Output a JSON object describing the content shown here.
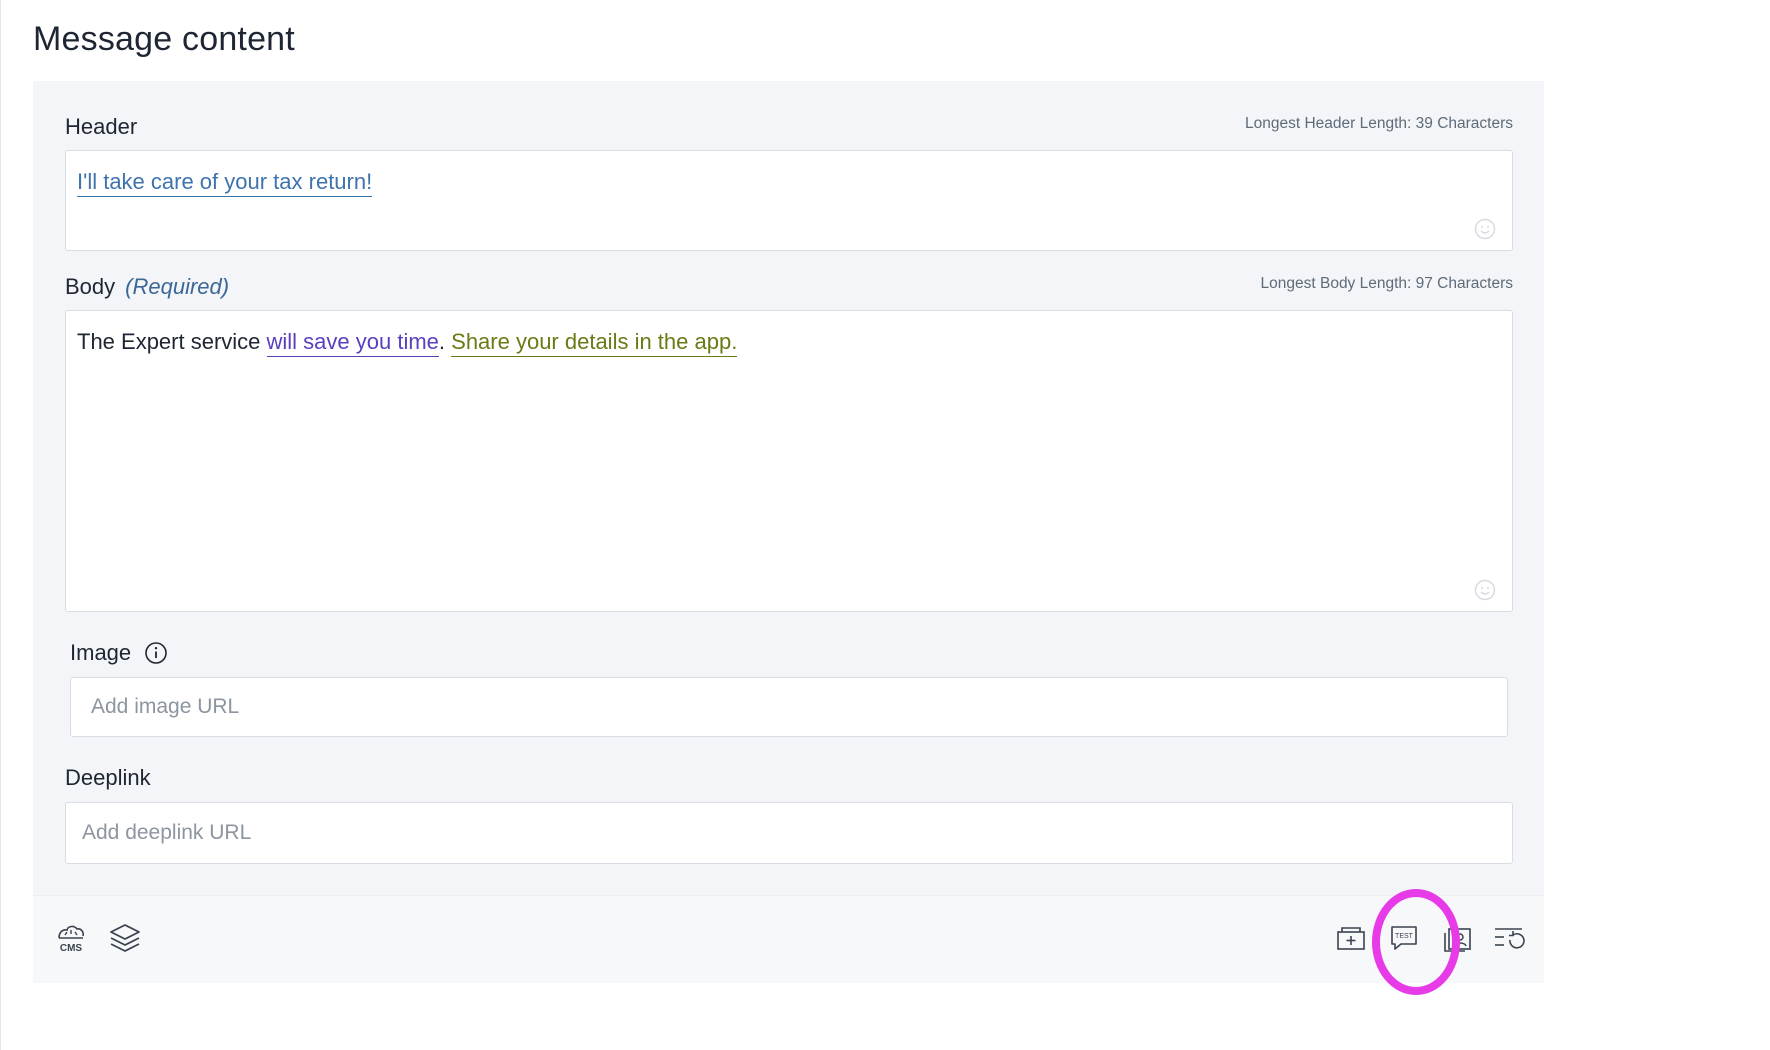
{
  "page": {
    "title": "Message content"
  },
  "header_field": {
    "label": "Header",
    "meta": "Longest Header Length: 39 Characters",
    "value": "I'll take care of your tax return!"
  },
  "body_field": {
    "label": "Body",
    "required": "(Required)",
    "meta": "Longest Body Length: 97 Characters",
    "segments": [
      "The Expert service ",
      "will save you time",
      ". ",
      "Share your details in the app."
    ]
  },
  "image_field": {
    "label": "Image",
    "placeholder": "Add image URL"
  },
  "deeplink_field": {
    "label": "Deeplink",
    "placeholder": "Add deeplink URL"
  },
  "toolbar": {
    "left": [
      "cms-icon",
      "layers-icon"
    ],
    "right": [
      "add-card-icon",
      "test-message-icon",
      "contact-card-icon",
      "reset-list-icon"
    ],
    "cms_text": "CMS",
    "test_text": "TEST"
  },
  "colors": {
    "highlight": "#e63be6",
    "header_link": "#3f73ad",
    "body_purple": "#5b3fbf",
    "body_olive": "#6a7a14"
  }
}
